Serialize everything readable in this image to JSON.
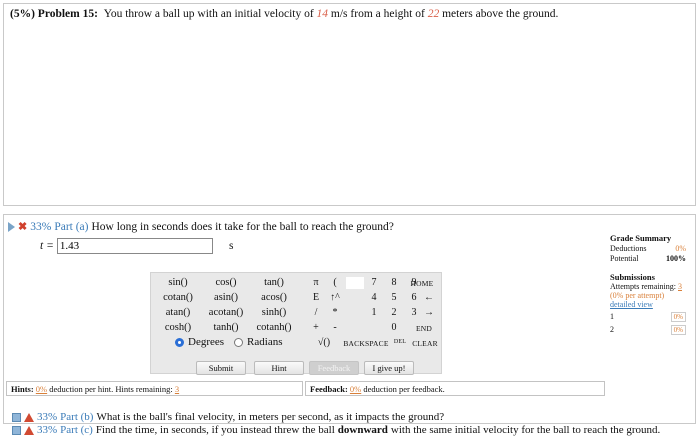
{
  "problem": {
    "percent": "(5%)",
    "label": "Problem 15:",
    "text_before_velocity": "You throw a ball up with an initial velocity of",
    "velocity": "14",
    "text_middle": "m/s from a height of",
    "height": "22",
    "text_after": "meters above the ground."
  },
  "part_a": {
    "percent": "33%",
    "part": "Part (a)",
    "question": "How long in seconds does it take for the ball to reach the ground?",
    "variable": "t =",
    "answer_value": "1.43",
    "unit": "s"
  },
  "calculator": {
    "functions": [
      [
        "sin()",
        "cos()",
        "tan()"
      ],
      [
        "cotan()",
        "asin()",
        "acos()"
      ],
      [
        "atan()",
        "acotan()",
        "sinh()"
      ],
      [
        "cosh()",
        "tanh()",
        "cotanh()"
      ]
    ],
    "symbols": [
      [
        "π",
        "("
      ],
      [
        "E",
        "↑^"
      ],
      [
        "/",
        "*"
      ],
      [
        "+",
        "-"
      ]
    ],
    "digits": [
      [
        "7",
        "8",
        "9"
      ],
      [
        "4",
        "5",
        "6"
      ],
      [
        "1",
        "2",
        "3"
      ]
    ],
    "zero": "0",
    "sqrt": "√()",
    "backspace": "BACKSPACE",
    "del": "DEL",
    "clear": "CLEAR",
    "home": "HOME",
    "end": "END",
    "left_arrow": "←",
    "right_arrow": "→",
    "degrees": "Degrees",
    "radians": "Radians",
    "selected_mode": "Degrees"
  },
  "buttons": {
    "submit": "Submit",
    "hint": "Hint",
    "feedback": "Feedback",
    "give_up": "I give up!"
  },
  "hints_bar": {
    "label": "Hints:",
    "pct": "0%",
    "text": "deduction per hint. Hints remaining:",
    "remaining": "3"
  },
  "feedback_bar": {
    "label": "Feedback:",
    "pct": "0%",
    "text": "deduction per feedback."
  },
  "grade_summary": {
    "title": "Grade Summary",
    "deductions_label": "Deductions",
    "deductions_value": "0%",
    "potential_label": "Potential",
    "potential_value": "100%"
  },
  "submissions": {
    "title": "Submissions",
    "attempts_text": "Attempts remaining:",
    "attempts_remaining": "3",
    "per_attempt": "(0% per attempt)",
    "detailed_view": "detailed view",
    "attempts": [
      {
        "n": "1",
        "value": "0%"
      },
      {
        "n": "2",
        "value": "0%"
      }
    ]
  },
  "part_b": {
    "percent": "33%",
    "part": "Part (b)",
    "question": "What is the ball's final velocity, in meters per second, as it impacts the ground?"
  },
  "part_c": {
    "percent": "33%",
    "part": "Part (c)",
    "question_before": "Find the time, in seconds, if you instead threw the ball",
    "emphasis": "downward",
    "question_after": "with the same initial velocity for the ball to reach the ground."
  },
  "colors": {
    "accent_blue": "#3a7bb8",
    "highlight_red": "#d9604a",
    "radio_selected": "#2b6fd6",
    "calculator_bg": "#e9e9e9"
  }
}
